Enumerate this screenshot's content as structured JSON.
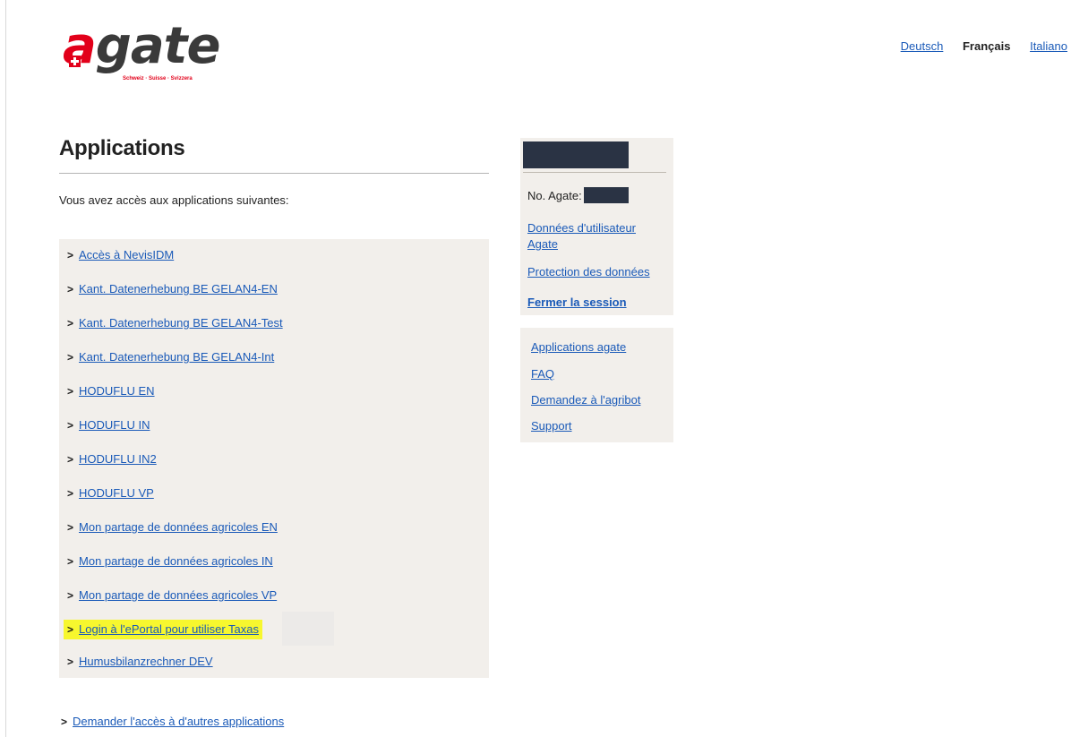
{
  "logo": {
    "wordmark_first": "a",
    "wordmark_rest": "gate",
    "tagline": "Schweiz · Suisse · Svizzera"
  },
  "languages": {
    "de": "Deutsch",
    "fr": "Français",
    "it": "Italiano",
    "active": "fr"
  },
  "main": {
    "title": "Applications",
    "intro": "Vous avez accès aux applications suivantes:",
    "apps": [
      "Accès à NevisIDM",
      "Kant. Datenerhebung BE GELAN4-EN",
      "Kant. Datenerhebung BE GELAN4-Test",
      "Kant. Datenerhebung BE GELAN4-Int",
      "HODUFLU EN",
      "HODUFLU IN",
      "HODUFLU IN2",
      "HODUFLU VP",
      "Mon partage de données agricoles EN",
      "Mon partage de données agricoles IN",
      "Mon partage de données agricoles VP",
      "Login à l'ePortal pour utiliser Taxas",
      "Humusbilanzrechner DEV"
    ],
    "request_access": "Demander l'accès à d'autres applications"
  },
  "sidebar": {
    "agate_no_label": "No. Agate:",
    "user_data_line1": "Données d'utilisateur",
    "user_data_line2": "Agate",
    "privacy": "Protection des données",
    "logout": "Fermer la session",
    "links": [
      "Applications agate",
      "FAQ",
      "Demandez à l'agribot",
      "Support"
    ]
  },
  "colors": {
    "link": "#1a5ab8",
    "brand_red": "#e2001a",
    "panel_bg": "#f2efeb",
    "highlight": "#f7f72e"
  }
}
